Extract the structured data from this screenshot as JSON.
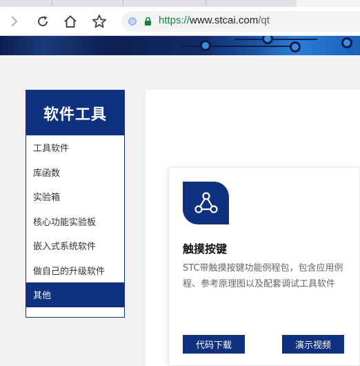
{
  "browser": {
    "url_protocol": "https://",
    "url_host": "www.stcai.com",
    "url_path": "/qt"
  },
  "sidebar": {
    "title": "软件工具",
    "items": [
      {
        "label": "工具软件"
      },
      {
        "label": "库函数"
      },
      {
        "label": "实验箱"
      },
      {
        "label": "核心功能实验板"
      },
      {
        "label": "嵌入式系统软件"
      },
      {
        "label": "做自己的升级软件"
      },
      {
        "label": "其他",
        "active": true
      }
    ]
  },
  "card": {
    "icon": "share-nodes-icon",
    "title": "触摸按键",
    "description": "STC带触摸按键功能例程包，包含应用例程、参考原理图以及配套调试工具软件",
    "buttons": {
      "download": "代码下载",
      "video": "演示视频"
    }
  },
  "colors": {
    "brand": "#103080",
    "url_secure": "#188038"
  }
}
